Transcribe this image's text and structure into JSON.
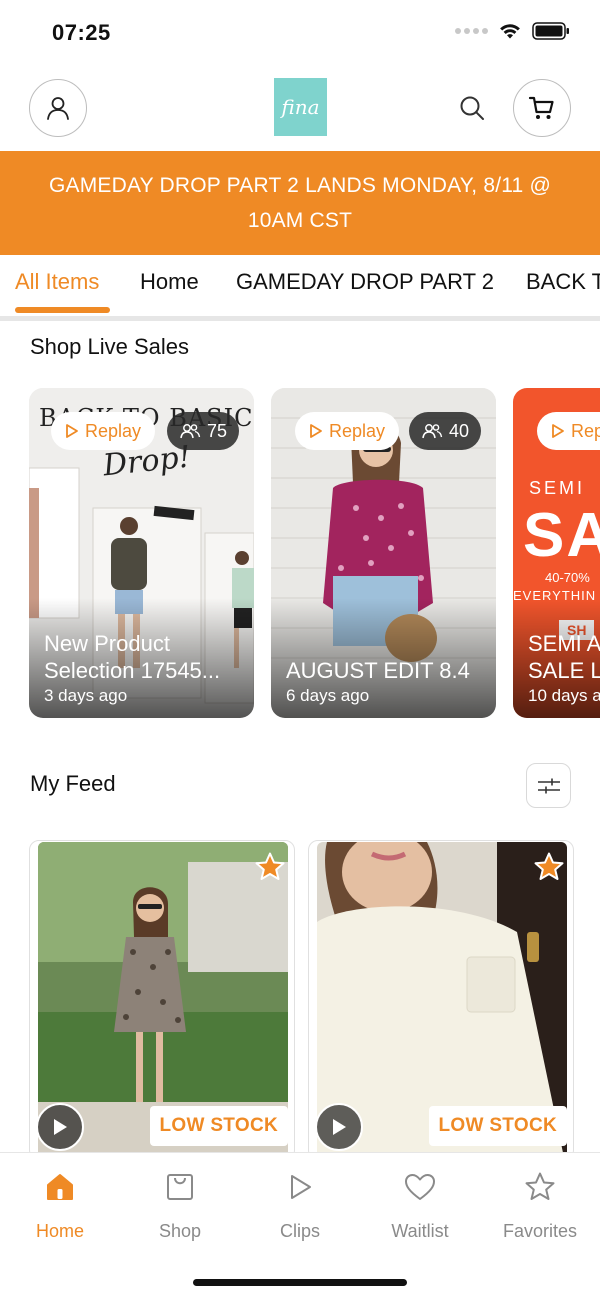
{
  "status_bar": {
    "time": "07:25"
  },
  "header": {
    "logo_text": "fina"
  },
  "banner": {
    "text": "GAMEDAY DROP PART 2 LANDS MONDAY, 8/11 @ 10AM CST"
  },
  "tabs": [
    {
      "label": "All Items",
      "active": true
    },
    {
      "label": "Home",
      "active": false
    },
    {
      "label": "GAMEDAY DROP PART 2",
      "active": false
    },
    {
      "label": "BACK T",
      "active": false
    }
  ],
  "live_sales": {
    "title": "Shop Live Sales",
    "cards": [
      {
        "replay_label": "Replay",
        "viewers": "75",
        "title_line1": "New Product",
        "title_line2": "Selection 17545...",
        "time": "3 days ago",
        "overlay_text_1": "BACK TO BASICS",
        "overlay_text_2": "Drop!"
      },
      {
        "replay_label": "Replay",
        "viewers": "40",
        "title_line1": "",
        "title_line2": "AUGUST EDIT 8.4",
        "time": "6 days ago"
      },
      {
        "replay_label": "Rep",
        "title_line1": "SEMI A",
        "title_line2": "SALE L",
        "time": "10 days a",
        "overlay_text_1": "SEMI",
        "overlay_text_2": "SA",
        "overlay_text_3": "40-70%",
        "overlay_text_4": "EVERYTHIN",
        "overlay_text_5": "SH"
      }
    ]
  },
  "feed": {
    "title": "My Feed",
    "items": [
      {
        "badge": "LOW STOCK"
      },
      {
        "badge": "LOW STOCK"
      }
    ]
  },
  "bottom_nav": [
    {
      "label": "Home",
      "icon": "home-icon",
      "active": true
    },
    {
      "label": "Shop",
      "icon": "shopping-bag-icon",
      "active": false
    },
    {
      "label": "Clips",
      "icon": "play-icon",
      "active": false
    },
    {
      "label": "Waitlist",
      "icon": "heart-icon",
      "active": false
    },
    {
      "label": "Favorites",
      "icon": "star-icon",
      "active": false
    }
  ],
  "colors": {
    "accent": "#ef8a25",
    "logo_bg": "#7fd3cd",
    "muted": "#8a8a8a"
  }
}
